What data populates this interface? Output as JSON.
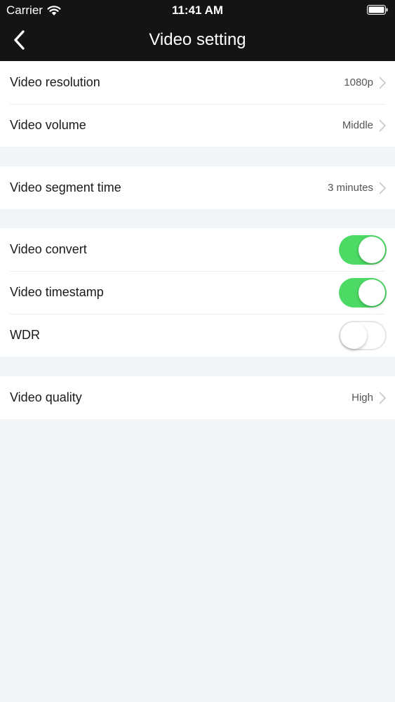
{
  "status_bar": {
    "carrier": "Carrier",
    "time": "11:41 AM",
    "wifi_icon": "wifi-icon",
    "battery_icon": "battery-icon"
  },
  "nav": {
    "title": "Video setting",
    "back_icon": "chevron-left-icon"
  },
  "settings": {
    "resolution": {
      "label": "Video resolution",
      "value": "1080p"
    },
    "volume": {
      "label": "Video volume",
      "value": "Middle"
    },
    "segment_time": {
      "label": "Video segment time",
      "value": "3 minutes"
    },
    "convert": {
      "label": "Video convert",
      "enabled": true
    },
    "timestamp": {
      "label": "Video timestamp",
      "enabled": true
    },
    "wdr": {
      "label": "WDR",
      "enabled": false
    },
    "quality": {
      "label": "Video quality",
      "value": "High"
    }
  },
  "colors": {
    "header_background": "#141414",
    "page_background": "#f2f5f7",
    "toggle_on": "#4cd964",
    "chevron": "#c7c7cc"
  }
}
